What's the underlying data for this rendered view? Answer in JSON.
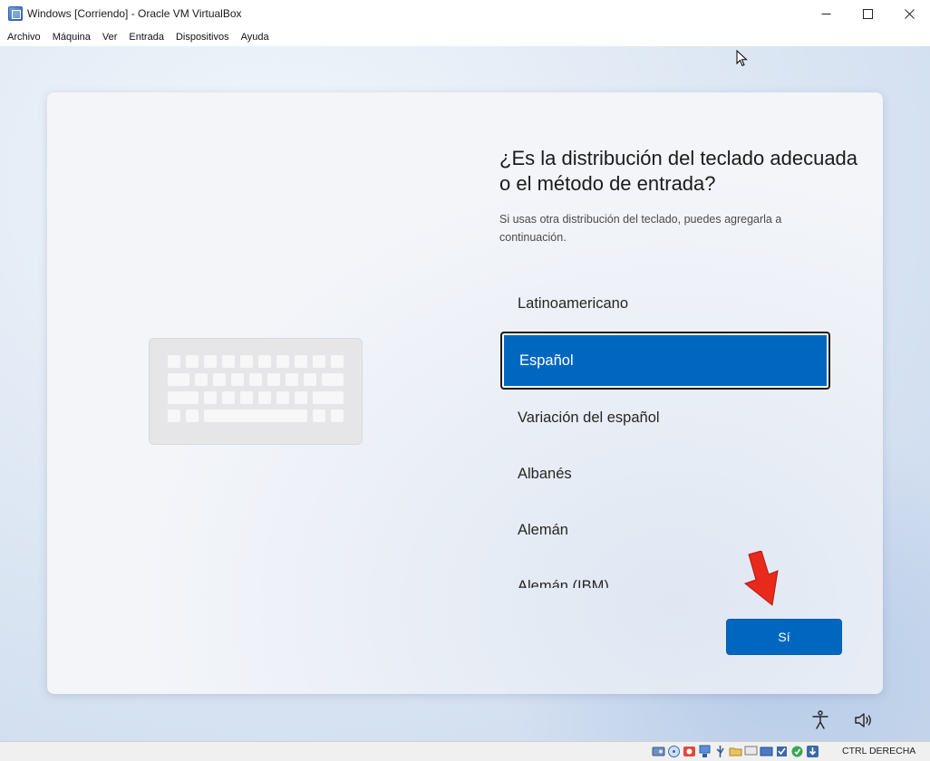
{
  "window": {
    "title": "Windows [Corriendo] - Oracle VM VirtualBox",
    "controls": {
      "minimize": "—",
      "maximize": "☐",
      "close": "✕"
    }
  },
  "menu": {
    "items": [
      "Archivo",
      "Máquina",
      "Ver",
      "Entrada",
      "Dispositivos",
      "Ayuda"
    ]
  },
  "oobe": {
    "headline": "¿Es la distribución del teclado adecuada o el método de entrada?",
    "subtext": "Si usas otra distribución del teclado, puedes agregarla a continuación.",
    "layouts": [
      "Latinoamericano",
      "Español",
      "Variación del español",
      "Albanés",
      "Alemán",
      "Alemán (IBM)"
    ],
    "selected": "Español",
    "confirm_label": "Sí"
  },
  "statusbar": {
    "host_key": "CTRL DERECHA",
    "icons": [
      "hard-disk-icon",
      "optical-drive-icon",
      "audio-icon",
      "network-icon",
      "usb-icon",
      "shared-folders-icon",
      "display-icon",
      "recording-icon",
      "mouse-integration-icon",
      "keyboard-icon",
      "download-icon"
    ]
  },
  "colors": {
    "accent": "#0067c0",
    "card_background": "#f3f5f9",
    "arrow": "#e8291c"
  }
}
